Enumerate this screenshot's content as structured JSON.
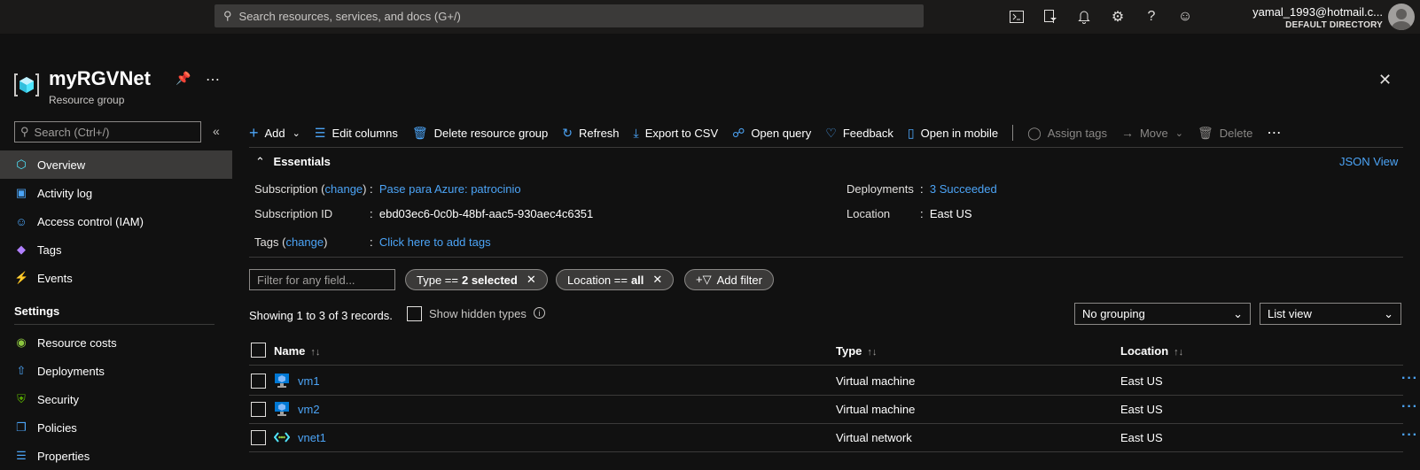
{
  "topbar": {
    "search_placeholder": "Search resources, services, and docs (G+/)",
    "icons": [
      "cloud-shell-icon",
      "directory-filter-icon",
      "notifications-icon",
      "settings-icon",
      "help-icon",
      "feedback-icon"
    ],
    "account_email": "yamal_1993@hotmail.c...",
    "account_directory": "DEFAULT DIRECTORY"
  },
  "header": {
    "title": "myRGVNet",
    "subtitle": "Resource group"
  },
  "sidebar": {
    "search_placeholder": "Search (Ctrl+/)",
    "items": [
      {
        "label": "Overview",
        "icon": "overview-icon",
        "active": true
      },
      {
        "label": "Activity log",
        "icon": "activity-log-icon"
      },
      {
        "label": "Access control (IAM)",
        "icon": "iam-icon"
      },
      {
        "label": "Tags",
        "icon": "tag-icon"
      },
      {
        "label": "Events",
        "icon": "events-icon"
      }
    ],
    "section_settings": "Settings",
    "settings_items": [
      {
        "label": "Resource costs",
        "icon": "resource-costs-icon"
      },
      {
        "label": "Deployments",
        "icon": "deployments-icon"
      },
      {
        "label": "Security",
        "icon": "security-icon"
      },
      {
        "label": "Policies",
        "icon": "policies-icon"
      },
      {
        "label": "Properties",
        "icon": "properties-icon"
      }
    ]
  },
  "toolbar": {
    "add": "Add",
    "edit_columns": "Edit columns",
    "delete_rg": "Delete resource group",
    "refresh": "Refresh",
    "export_csv": "Export to CSV",
    "open_query": "Open query",
    "feedback": "Feedback",
    "open_mobile": "Open in mobile",
    "assign_tags": "Assign tags",
    "move": "Move",
    "delete": "Delete"
  },
  "essentials": {
    "heading": "Essentials",
    "json_view": "JSON View",
    "subscription_label": "Subscription",
    "change_link": "change",
    "subscription_value": "Pase para Azure: patrocinio",
    "subscription_id_label": "Subscription ID",
    "subscription_id_value": "ebd03ec6-0c0b-48bf-aac5-930aec4c6351",
    "tags_label": "Tags",
    "tags_value": "Click here to add tags",
    "deployments_label": "Deployments",
    "deployments_value": "3 Succeeded",
    "location_label": "Location",
    "location_value": "East US"
  },
  "filters": {
    "placeholder": "Filter for any field...",
    "type_prefix": "Type ==",
    "type_value": "2 selected",
    "location_prefix": "Location ==",
    "location_value": "all",
    "add_filter": "Add filter"
  },
  "list": {
    "showing": "Showing 1 to 3 of 3 records.",
    "show_hidden": "Show hidden types",
    "grouping": "No grouping",
    "view": "List view",
    "columns": [
      "Name",
      "Type",
      "Location"
    ],
    "rows": [
      {
        "name": "vm1",
        "type": "Virtual machine",
        "location": "East US",
        "icon": "virtual-machine-icon"
      },
      {
        "name": "vm2",
        "type": "Virtual machine",
        "location": "East US",
        "icon": "virtual-machine-icon"
      },
      {
        "name": "vnet1",
        "type": "Virtual network",
        "location": "East US",
        "icon": "virtual-network-icon"
      }
    ]
  }
}
